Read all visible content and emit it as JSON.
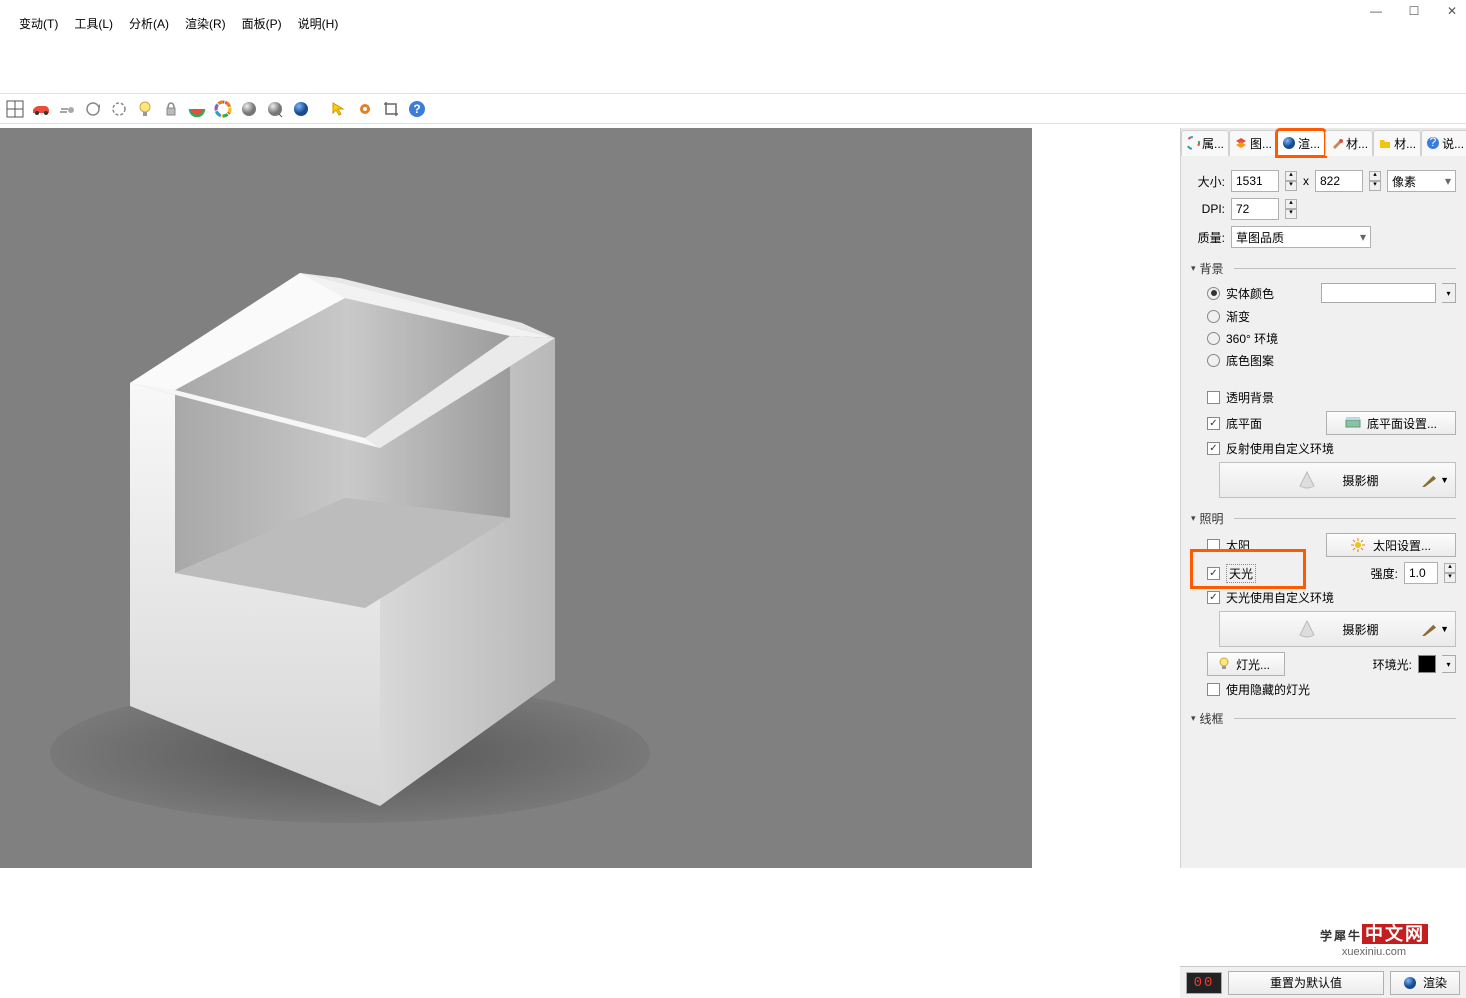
{
  "menu": {
    "items": [
      "变动(T)",
      "工具(L)",
      "分析(A)",
      "渲染(R)",
      "面板(P)",
      "说明(H)"
    ]
  },
  "tabs": {
    "items": [
      {
        "label": "属...",
        "icon": "circle-rainbow"
      },
      {
        "label": "图...",
        "icon": "layers"
      },
      {
        "label": "渲...",
        "icon": "globe",
        "active": true,
        "highlight": true
      },
      {
        "label": "材...",
        "icon": "brush"
      },
      {
        "label": "材...",
        "icon": "folder"
      },
      {
        "label": "说...",
        "icon": "help"
      }
    ]
  },
  "size": {
    "label": "大小:",
    "width": "1531",
    "x": "x",
    "height": "822",
    "unit": "像素"
  },
  "dpi": {
    "label": "DPI:",
    "value": "72"
  },
  "quality": {
    "label": "质量:",
    "value": "草图品质"
  },
  "background": {
    "header": "背景",
    "radios": {
      "solid": "实体颜色",
      "gradient": "渐变",
      "env360": "360° 环境",
      "wallpaper": "底色图案"
    },
    "transparent": "透明背景",
    "groundplane": "底平面",
    "groundplane_btn": "底平面设置...",
    "reflect_custom": "反射使用自定义环境",
    "studio": "摄影棚"
  },
  "lighting": {
    "header": "照明",
    "sun": "太阳",
    "sun_btn": "太阳设置...",
    "skylight": "天光",
    "intensity_label": "强度:",
    "intensity_value": "1.0",
    "skylight_custom": "天光使用自定义环境",
    "studio": "摄影棚",
    "lights_btn": "灯光...",
    "ambient_label": "环境光:",
    "use_hidden": "使用隐藏的灯光"
  },
  "wireframe": {
    "header": "线框"
  },
  "bottom": {
    "progress": "00",
    "reset": "重置为默认值",
    "render": "渲染"
  },
  "watermark": {
    "main": "学犀牛",
    "badge": "中文网",
    "sub": "xuexiniu.com"
  }
}
